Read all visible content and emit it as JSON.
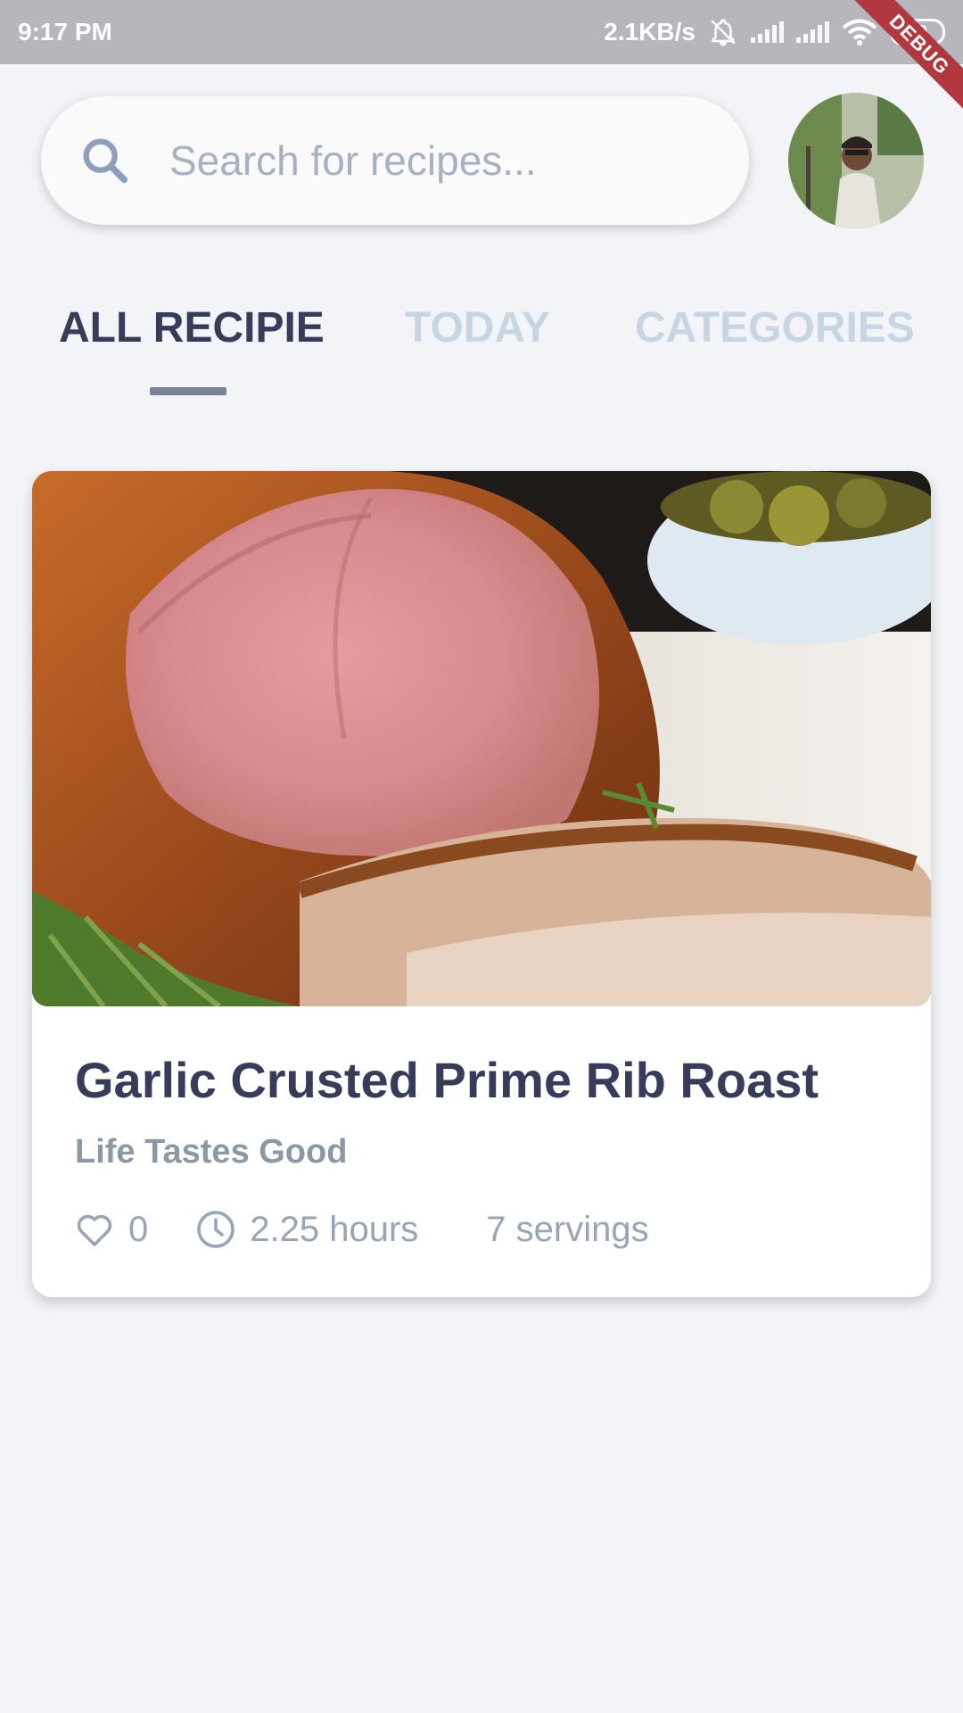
{
  "status_bar": {
    "time": "9:17 PM",
    "net_speed": "2.1KB/s",
    "battery": "80"
  },
  "debug_banner": "DEBUG",
  "search": {
    "placeholder": "Search for recipes...",
    "value": ""
  },
  "tabs": [
    {
      "label": "ALL RECIPIE",
      "active": true
    },
    {
      "label": "TODAY",
      "active": false
    },
    {
      "label": "CATEGORIES",
      "active": false
    }
  ],
  "recipe": {
    "title": "Garlic Crusted Prime Rib Roast",
    "author": "Life Tastes Good",
    "likes": "0",
    "duration": "2.25 hours",
    "servings": "7 servings"
  },
  "colors": {
    "background": "#f2f4f8",
    "title": "#363c5a",
    "inactive_tab": "#c8d6e3",
    "muted_text": "#99a5b4",
    "status_bar": "#b5b7bc",
    "debug_ribbon": "#b1383e"
  },
  "icons": {
    "search": "search-icon",
    "like": "heart-outline-icon",
    "time": "clock-icon",
    "notifications": "bell-off-icon",
    "wifi": "wifi-icon",
    "signal": "signal-icon",
    "battery": "battery-icon"
  }
}
